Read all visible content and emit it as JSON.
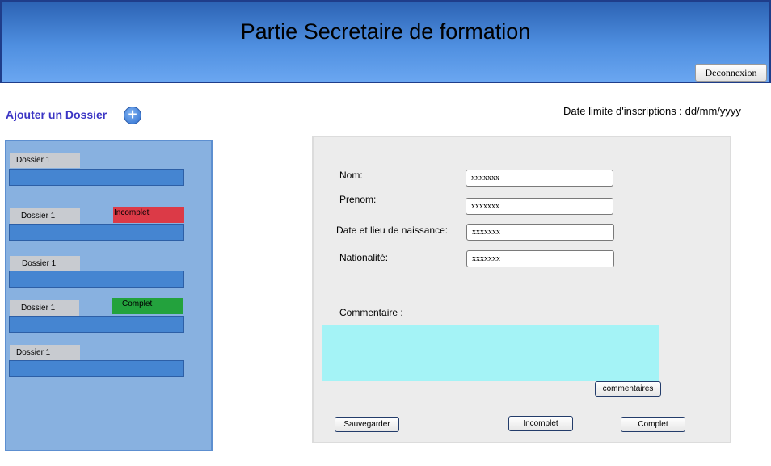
{
  "header": {
    "title": "Partie Secretaire de formation",
    "logout_label": "Deconnexion"
  },
  "toolbar": {
    "add_folder_label": "Ajouter un Dossier",
    "add_icon_glyph": "+",
    "add_icon": "plus-circle-icon"
  },
  "deadline": {
    "text": "Date limite d'inscriptions : dd/mm/yyyy"
  },
  "sidebar": {
    "items": [
      {
        "label": "Dossier 1",
        "status": "",
        "status_color": ""
      },
      {
        "label": "Dossier 1",
        "status": "Incomplet",
        "status_color": "#dc3a47"
      },
      {
        "label": "Dossier 1",
        "status": "",
        "status_color": ""
      },
      {
        "label": "Dossier 1",
        "status": "Complet",
        "status_color": "#23a23d"
      },
      {
        "label": "Dossier 1",
        "status": "",
        "status_color": ""
      }
    ]
  },
  "form": {
    "nom": {
      "label": "Nom:",
      "value": "xxxxxxx"
    },
    "prenom": {
      "label": "Prenom:",
      "value": "xxxxxxx"
    },
    "naissance": {
      "label": "Date et lieu de naissance:",
      "value": "xxxxxxx"
    },
    "nationalite": {
      "label": "Nationalité:",
      "value": "xxxxxxx"
    },
    "commentaire": {
      "label": "Commentaire :",
      "value": ""
    },
    "buttons": {
      "commentaires": "commentaires",
      "sauvegarder": "Sauvegarder",
      "incomplet": "Incomplet",
      "complet": "Complet"
    }
  },
  "colors": {
    "header_gradient": [
      "#2c63b4",
      "#6aa6f0"
    ],
    "sidebar_bg": "#88b1e0",
    "folder_bar": "#4585d1",
    "folder_tab": "#c8cbd0",
    "comment_bg": "#a4f3f6",
    "add_label": "#3b35c4"
  }
}
